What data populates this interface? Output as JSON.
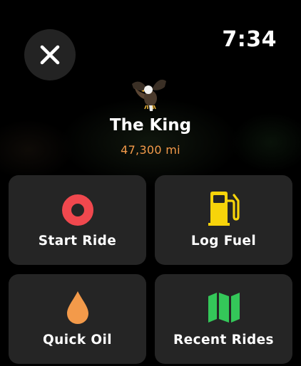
{
  "status": {
    "time": "7:34"
  },
  "profile": {
    "name": "The King",
    "mileage": "47,300 mi",
    "avatar_icon": "eagle-icon"
  },
  "actions": [
    {
      "label": "Start Ride",
      "icon": "record-icon",
      "color": "#f0484e"
    },
    {
      "label": "Log Fuel",
      "icon": "fuel-pump-icon",
      "color": "#f7d40a"
    },
    {
      "label": "Quick Oil",
      "icon": "oil-drop-icon",
      "color": "#f39a4a"
    },
    {
      "label": "Recent Rides",
      "icon": "map-icon",
      "color": "#34c759"
    }
  ],
  "colors": {
    "background": "#000000",
    "tile": "#252525",
    "accent": "#f39a4a"
  }
}
